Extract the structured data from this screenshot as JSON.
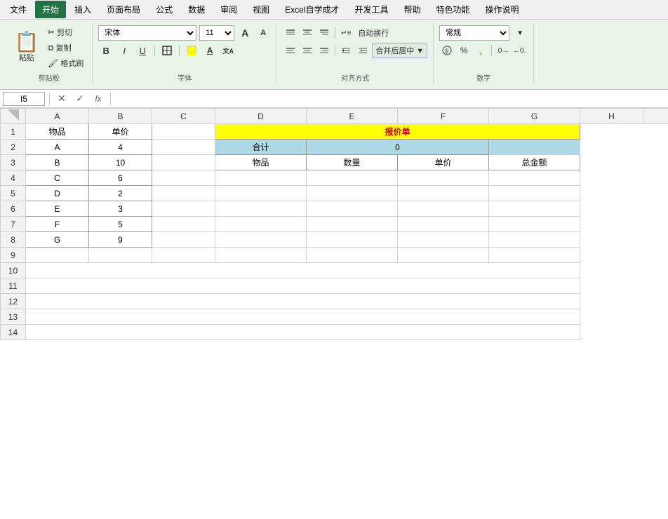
{
  "menu": {
    "items": [
      "文件",
      "开始",
      "插入",
      "页面布局",
      "公式",
      "数据",
      "审阅",
      "视图",
      "Excel自学成才",
      "开发工具",
      "帮助",
      "特色功能",
      "操作说明"
    ],
    "active": "开始"
  },
  "ribbon": {
    "clipboard": {
      "label": "剪贴板",
      "paste": "粘贴",
      "cut": "剪切",
      "copy": "复制",
      "format_painter": "格式刷"
    },
    "font": {
      "label": "字体",
      "name": "宋体",
      "size": "11",
      "grow": "A",
      "shrink": "A"
    },
    "alignment": {
      "label": "对齐方式",
      "auto_wrap": "自动换行",
      "merge": "合并后居中 ▼"
    },
    "number": {
      "label": "数字",
      "format": "常规"
    }
  },
  "formula_bar": {
    "cell_ref": "I5",
    "formula": ""
  },
  "grid": {
    "col_headers": [
      "",
      "A",
      "B",
      "C",
      "D",
      "E",
      "F",
      "G"
    ],
    "rows": [
      {
        "num": "1",
        "cells": [
          "物品",
          "单价",
          "",
          "报价单",
          "",
          "",
          ""
        ]
      },
      {
        "num": "2",
        "cells": [
          "A",
          "4",
          "",
          "合计",
          "",
          "0",
          ""
        ]
      },
      {
        "num": "3",
        "cells": [
          "B",
          "10",
          "",
          "物品",
          "数量",
          "单价",
          "总金额"
        ]
      },
      {
        "num": "4",
        "cells": [
          "C",
          "6",
          "",
          "",
          "",
          "",
          ""
        ]
      },
      {
        "num": "5",
        "cells": [
          "D",
          "2",
          "",
          "",
          "",
          "",
          ""
        ]
      },
      {
        "num": "6",
        "cells": [
          "E",
          "3",
          "",
          "",
          "",
          "",
          ""
        ]
      },
      {
        "num": "7",
        "cells": [
          "F",
          "5",
          "",
          "",
          "",
          "",
          ""
        ]
      },
      {
        "num": "8",
        "cells": [
          "G",
          "9",
          "",
          "",
          "",
          "",
          ""
        ]
      },
      {
        "num": "9",
        "cells": [
          "",
          "",
          "",
          "",
          "",
          "",
          ""
        ]
      },
      {
        "num": "10",
        "cells": [
          "",
          "",
          "",
          "",
          "",
          "",
          ""
        ]
      },
      {
        "num": "11",
        "cells": [
          "",
          "",
          "",
          "",
          "",
          "",
          ""
        ]
      },
      {
        "num": "12",
        "cells": [
          "",
          "",
          "",
          "",
          "",
          "",
          ""
        ]
      },
      {
        "num": "13",
        "cells": [
          "",
          "",
          "",
          "",
          "",
          "",
          ""
        ]
      },
      {
        "num": "14",
        "cells": [
          "",
          "",
          "",
          "",
          "",
          "",
          ""
        ]
      }
    ]
  }
}
